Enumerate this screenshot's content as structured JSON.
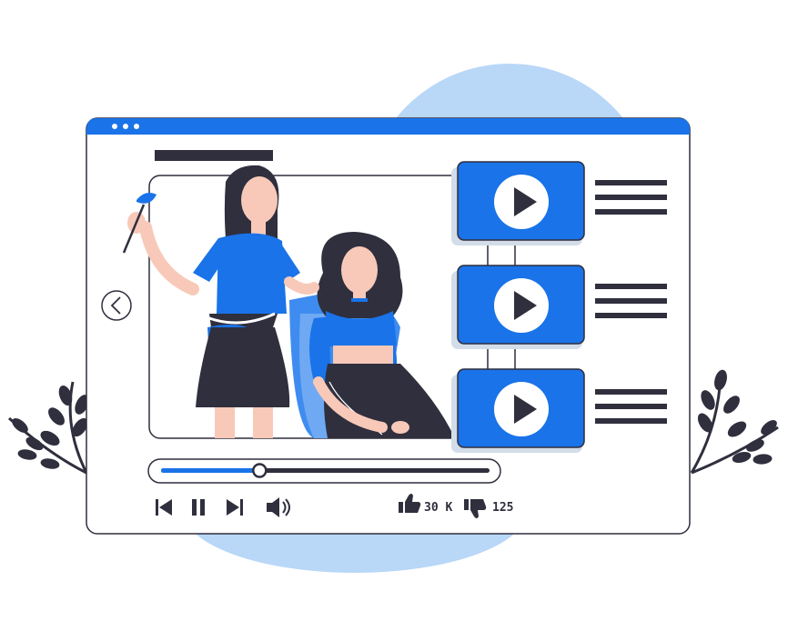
{
  "window": {
    "accent_color": "#1a73e8",
    "title_bar_dots": 3
  },
  "video": {
    "progress_fraction": 0.3
  },
  "controls": {
    "buttons": [
      "skip-back-icon",
      "pause-icon",
      "skip-forward-icon",
      "volume-icon"
    ]
  },
  "stats": {
    "likes": "30 K",
    "dislikes": "125"
  },
  "playlist": {
    "items": [
      {
        "icon": "play-icon"
      },
      {
        "icon": "play-icon"
      },
      {
        "icon": "play-icon"
      }
    ]
  },
  "colors": {
    "blue": "#1a73e8",
    "light_blue_blob": "#b9d7f7",
    "dark": "#2f2f3e",
    "white": "#ffffff"
  }
}
